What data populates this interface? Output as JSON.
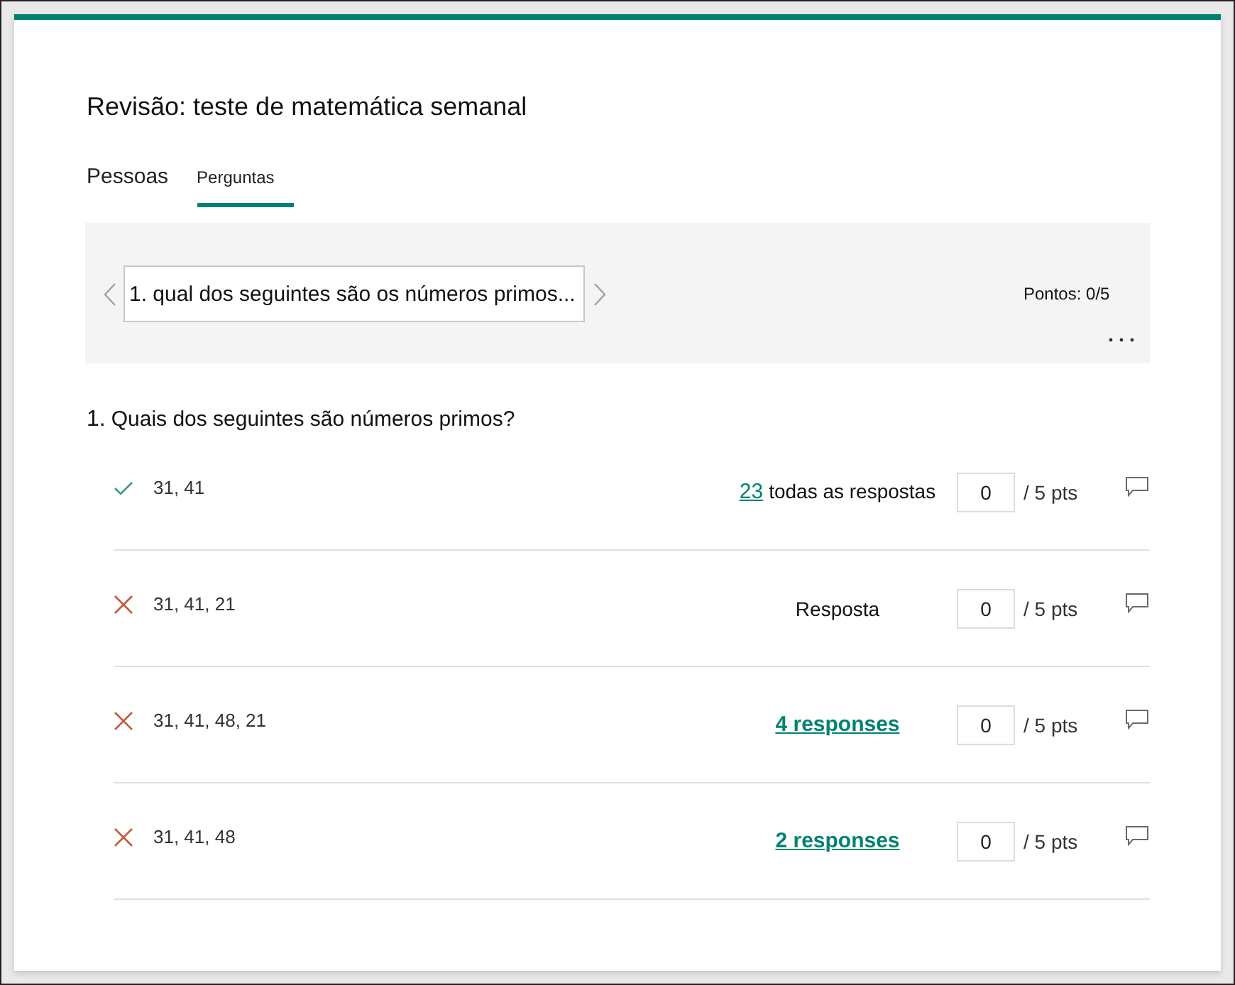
{
  "header": {
    "title": "Revisão: teste de matemática semanal"
  },
  "tabs": [
    {
      "label": "Pessoas",
      "selected": false
    },
    {
      "label": "Perguntas",
      "selected": true
    }
  ],
  "question_nav": {
    "current_question": "1. qual dos seguintes são os números primos...",
    "points": "Pontos: 0/5"
  },
  "question": {
    "number": "1.",
    "text": "Quais dos seguintes são números primos?"
  },
  "answers": [
    {
      "text": "31, 41",
      "correct": true,
      "responses": {
        "kind": "link_label",
        "link": "23",
        "label": "todas as respostas"
      },
      "score": "0",
      "max_points": "/ 5 pts"
    },
    {
      "text": "31, 41, 21",
      "correct": false,
      "responses": {
        "kind": "label",
        "label": "Resposta"
      },
      "score": "0",
      "max_points": "/ 5 pts"
    },
    {
      "text": "31, 41, 48, 21",
      "correct": false,
      "responses": {
        "kind": "link",
        "link": "4 responses"
      },
      "score": "0",
      "max_points": "/ 5 pts"
    },
    {
      "text": "31, 41, 48",
      "correct": false,
      "responses": {
        "kind": "link",
        "link": "2 responses"
      },
      "score": "0",
      "max_points": "/ 5 pts"
    }
  ]
}
